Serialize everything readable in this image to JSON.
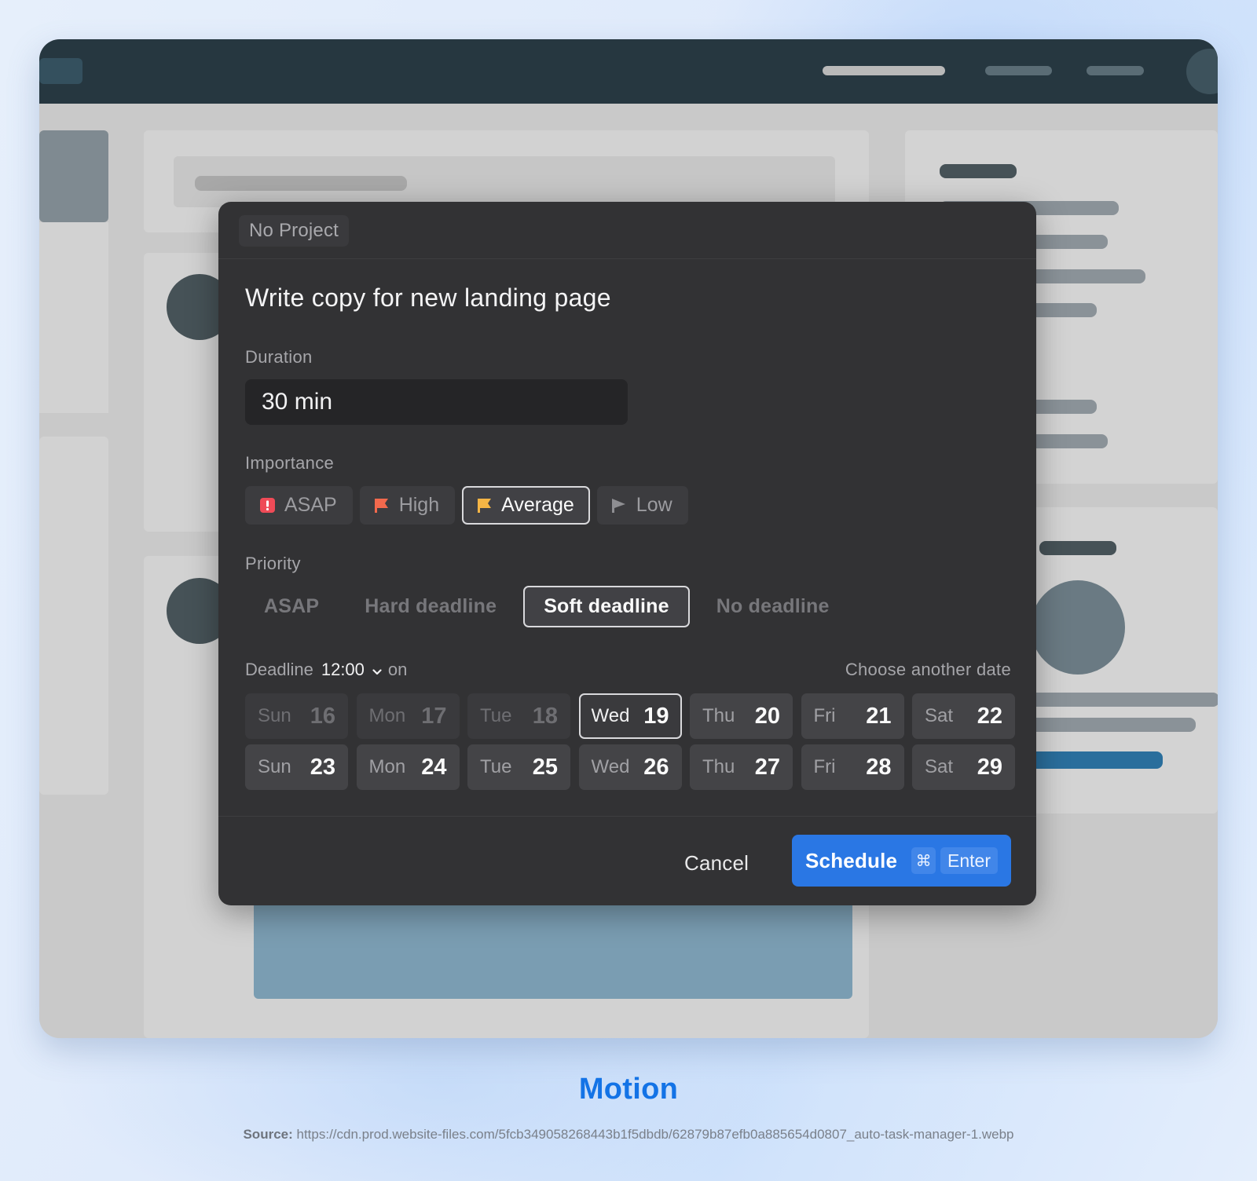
{
  "modal": {
    "project": "No Project",
    "task_title": "Write copy for new landing page",
    "duration": {
      "label": "Duration",
      "value": "30 min"
    },
    "importance": {
      "label": "Importance",
      "options": [
        {
          "label": "ASAP",
          "icon": "exclamation-square-icon",
          "color": "#ef4b57",
          "selected": false
        },
        {
          "label": "High",
          "icon": "flag-icon",
          "color": "#f2694d",
          "selected": false
        },
        {
          "label": "Average",
          "icon": "flag-icon",
          "color": "#f5b545",
          "selected": true
        },
        {
          "label": "Low",
          "icon": "flag-icon",
          "color": "#8e8e92",
          "selected": false
        }
      ]
    },
    "priority": {
      "label": "Priority",
      "options": [
        {
          "label": "ASAP",
          "selected": false
        },
        {
          "label": "Hard deadline",
          "selected": false
        },
        {
          "label": "Soft deadline",
          "selected": true
        },
        {
          "label": "No deadline",
          "selected": false
        }
      ]
    },
    "deadline": {
      "label": "Deadline",
      "time": "12:00",
      "on_label": "on",
      "choose_another": "Choose another date",
      "days": [
        {
          "day": "Sun",
          "date": "16",
          "state": "past"
        },
        {
          "day": "Mon",
          "date": "17",
          "state": "past"
        },
        {
          "day": "Tue",
          "date": "18",
          "state": "past"
        },
        {
          "day": "Wed",
          "date": "19",
          "state": "selected"
        },
        {
          "day": "Thu",
          "date": "20",
          "state": "available"
        },
        {
          "day": "Fri",
          "date": "21",
          "state": "available"
        },
        {
          "day": "Sat",
          "date": "22",
          "state": "available"
        },
        {
          "day": "Sun",
          "date": "23",
          "state": "available"
        },
        {
          "day": "Mon",
          "date": "24",
          "state": "available"
        },
        {
          "day": "Tue",
          "date": "25",
          "state": "available"
        },
        {
          "day": "Wed",
          "date": "26",
          "state": "available"
        },
        {
          "day": "Thu",
          "date": "27",
          "state": "available"
        },
        {
          "day": "Fri",
          "date": "28",
          "state": "available"
        },
        {
          "day": "Sat",
          "date": "29",
          "state": "available"
        }
      ]
    },
    "footer": {
      "cancel": "Cancel",
      "schedule": "Schedule",
      "shortcut_key1": "⌘",
      "shortcut_key2": "Enter",
      "accent_color": "#2a77e4"
    }
  },
  "caption": {
    "title": "Motion",
    "source_label": "Source:",
    "source_url": "https://cdn.prod.website-files.com/5fcb349058268443b1f5dbdb/62879b87efb0a885654d0807_auto-task-manager-1.webp"
  }
}
